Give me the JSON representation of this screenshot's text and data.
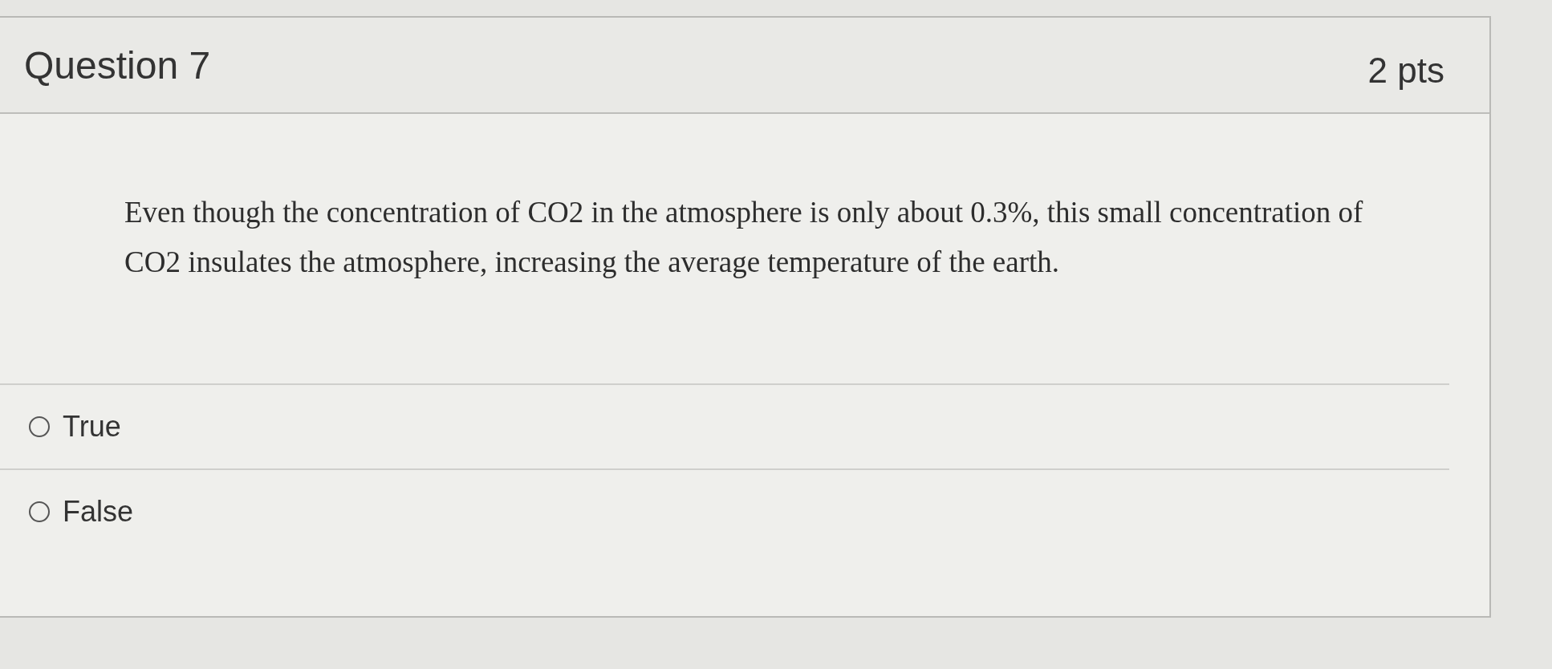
{
  "question": {
    "title": "Question 7",
    "points": "2 pts",
    "text": "Even though the concentration of CO2 in the atmosphere is only about 0.3%, this small concentration of CO2 insulates the atmosphere, increasing the average temperature of the earth.",
    "answers": [
      {
        "label": "True",
        "selected": false
      },
      {
        "label": "False",
        "selected": false
      }
    ]
  }
}
